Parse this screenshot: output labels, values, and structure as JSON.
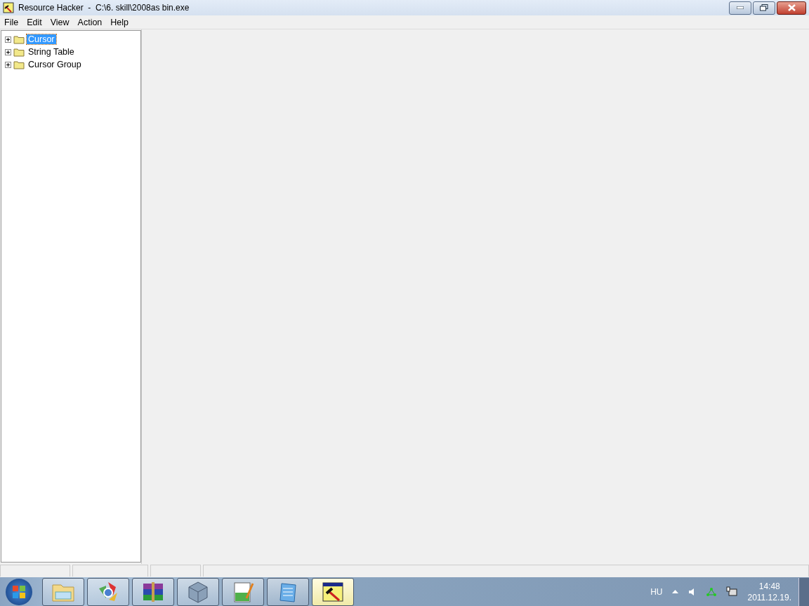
{
  "window": {
    "title": "Resource Hacker  -  C:\\6. skill\\2008as bin.exe"
  },
  "menu": [
    "File",
    "Edit",
    "View",
    "Action",
    "Help"
  ],
  "tree": [
    {
      "label": "Cursor",
      "selected": true,
      "expanded": false
    },
    {
      "label": "String Table",
      "selected": false,
      "expanded": false
    },
    {
      "label": "Cursor Group",
      "selected": false,
      "expanded": false
    }
  ],
  "taskbar": {
    "apps": [
      {
        "kind": "folder",
        "selected": false
      },
      {
        "kind": "browser",
        "selected": false
      },
      {
        "kind": "archive",
        "selected": false
      },
      {
        "kind": "cube",
        "selected": false
      },
      {
        "kind": "editor",
        "selected": false
      },
      {
        "kind": "notepad",
        "selected": false
      },
      {
        "kind": "hacker",
        "selected": true
      }
    ],
    "language": "HU",
    "time": "14:48",
    "date": "2011.12.19."
  }
}
